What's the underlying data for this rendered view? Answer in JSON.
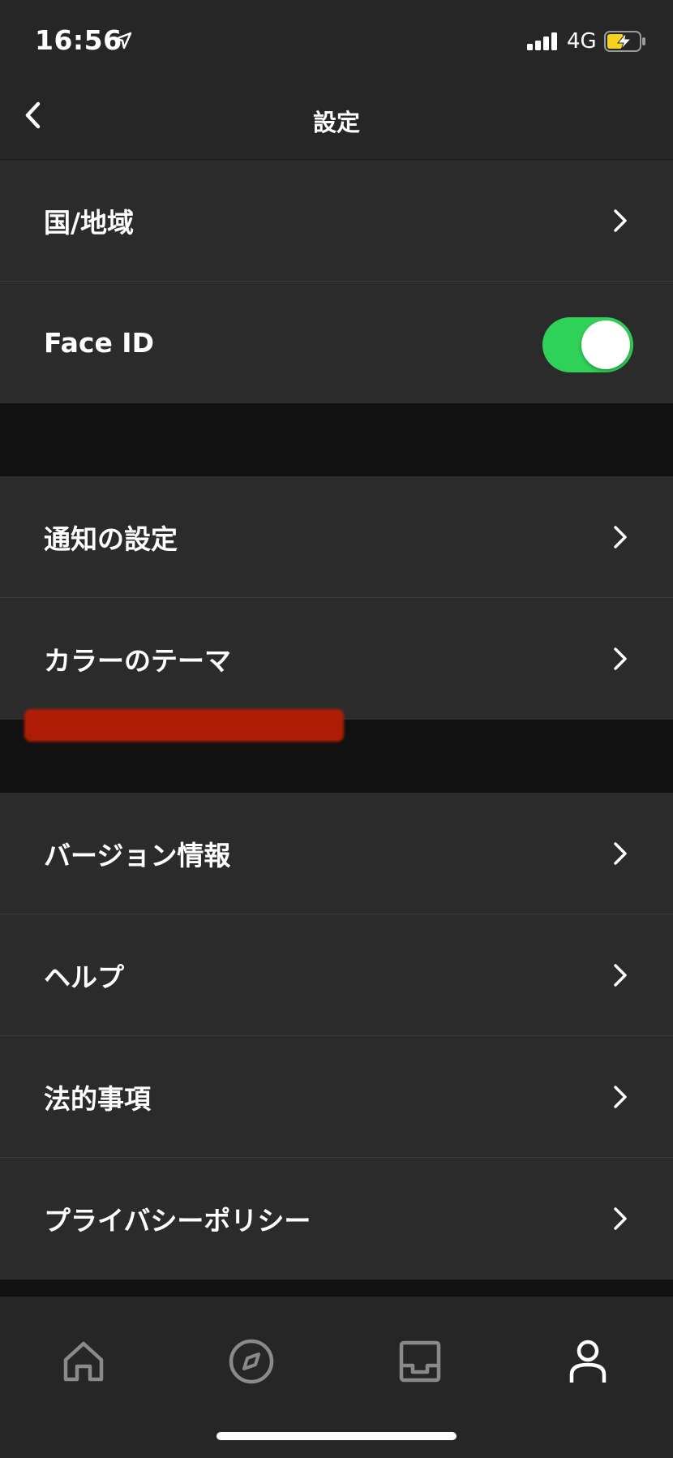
{
  "status_bar": {
    "time": "16:56",
    "network": "4G",
    "battery_color": "#f4d21f"
  },
  "nav": {
    "title": "設定"
  },
  "groups": {
    "g1": {
      "region": "国/地域",
      "face_id": "Face ID",
      "face_id_enabled": true
    },
    "g2": {
      "notifications": "通知の設定",
      "color_theme": "カラーのテーマ"
    },
    "g3": {
      "version": "バージョン情報",
      "help": "ヘルプ",
      "legal": "法的事項",
      "privacy": "プライバシーポリシー"
    }
  },
  "colors": {
    "accent_toggle": "#30d158",
    "background": "#111111",
    "row_bg": "#2b2b2b"
  },
  "tabbar": {
    "icons": [
      "home-icon",
      "compass-icon",
      "inbox-icon",
      "profile-icon"
    ],
    "active": "profile-icon"
  }
}
